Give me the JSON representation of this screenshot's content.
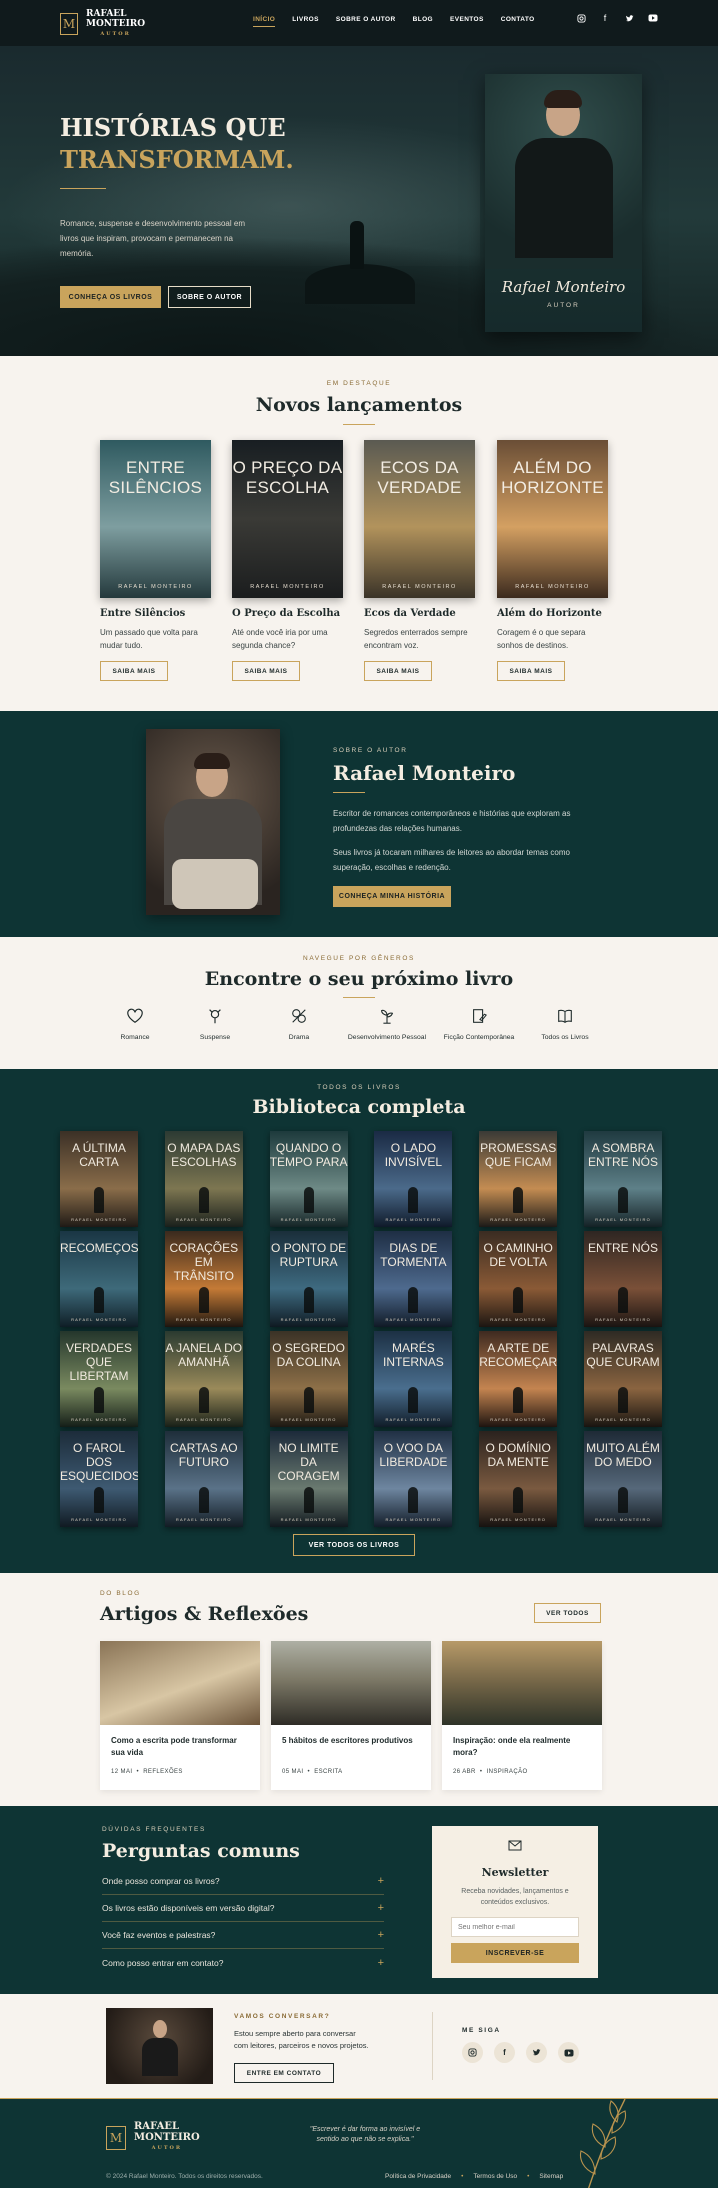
{
  "header": {
    "logo_mark": "M",
    "logo_line1": "RAFAEL",
    "logo_line2": "MONTEIRO",
    "logo_sub": "AUTOR",
    "nav": [
      "INÍCIO",
      "LIVROS",
      "SOBRE O AUTOR",
      "BLOG",
      "EVENTOS",
      "CONTATO"
    ],
    "social_icons": [
      "instagram-icon",
      "facebook-icon",
      "twitter-icon",
      "youtube-icon"
    ]
  },
  "hero": {
    "title_line1": "HISTÓRIAS QUE",
    "title_line2": "TRANSFORMAM.",
    "description": "Romance, suspense e desenvolvimento pessoal em livros que inspiram, provocam e permanecem na memória.",
    "primary_button": "CONHEÇA OS LIVROS",
    "secondary_button": "SOBRE O AUTOR",
    "portrait_signature": "Rafael Monteiro",
    "portrait_role": "AUTOR"
  },
  "releases": {
    "eyebrow": "EM DESTAQUE",
    "title": "Novos lançamentos",
    "books": [
      {
        "cover_title": "ENTRE SILÊNCIOS",
        "cover_author": "RAFAEL MONTEIRO",
        "name": "Entre Silêncios",
        "desc": "Um passado que volta para mudar tudo.",
        "button": "SAIBA MAIS"
      },
      {
        "cover_title": "O PREÇO DA ESCOLHA",
        "cover_author": "RAFAEL MONTEIRO",
        "name": "O Preço da Escolha",
        "desc": "Até onde você iria por uma segunda chance?",
        "button": "SAIBA MAIS"
      },
      {
        "cover_title": "ECOS DA VERDADE",
        "cover_author": "RAFAEL MONTEIRO",
        "name": "Ecos da Verdade",
        "desc": "Segredos enterrados sempre encontram voz.",
        "button": "SAIBA MAIS"
      },
      {
        "cover_title": "ALÉM DO HORIZONTE",
        "cover_author": "RAFAEL MONTEIRO",
        "name": "Além do Horizonte",
        "desc": "Coragem é o que separa sonhos de destinos.",
        "button": "SAIBA MAIS"
      }
    ]
  },
  "about": {
    "eyebrow": "SOBRE O AUTOR",
    "title": "Rafael Monteiro",
    "p1": "Escritor de romances contemporâneos e histórias que exploram as profundezas das relações humanas.",
    "p2": "Seus livros já tocaram milhares de leitores ao abordar temas como superação, escolhas e redenção.",
    "button": "CONHEÇA MINHA HISTÓRIA"
  },
  "genres": {
    "eyebrow": "NAVEGUE POR GÊNEROS",
    "title": "Encontre o seu próximo livro",
    "items": [
      {
        "label": "Romance",
        "icon": "heart-icon"
      },
      {
        "label": "Suspense",
        "icon": "magnifier-icon"
      },
      {
        "label": "Drama",
        "icon": "masks-icon"
      },
      {
        "label": "Desenvolvimento Pessoal",
        "icon": "plant-icon"
      },
      {
        "label": "Ficção Contemporânea",
        "icon": "book-pen-icon"
      },
      {
        "label": "Todos os Livros",
        "icon": "open-book-icon"
      }
    ]
  },
  "library": {
    "eyebrow": "TODOS OS LIVROS",
    "title": "Biblioteca completa",
    "author": "RAFAEL MONTEIRO",
    "books": [
      "A ÚLTIMA CARTA",
      "O MAPA DAS ESCOLHAS",
      "QUANDO O TEMPO PARA",
      "O LADO INVISÍVEL",
      "PROMESSAS QUE FICAM",
      "A SOMBRA ENTRE NÓS",
      "RECOMEÇOS",
      "CORAÇÕES EM TRÂNSITO",
      "O PONTO DE RUPTURA",
      "DIAS DE TORMENTA",
      "O CAMINHO DE VOLTA",
      "ENTRE NÓS",
      "VERDADES QUE LIBERTAM",
      "A JANELA DO AMANHÃ",
      "O SEGREDO DA COLINA",
      "MARÉS INTERNAS",
      "A ARTE DE RECOMEÇAR",
      "PALAVRAS QUE CURAM",
      "O FAROL DOS ESQUECIDOS",
      "CARTAS AO FUTURO",
      "NO LIMITE DA CORAGEM",
      "O VOO DA LIBERDADE",
      "O DOMÍNIO DA MENTE",
      "MUITO ALÉM DO MEDO"
    ],
    "button": "VER TODOS OS LIVROS"
  },
  "blog": {
    "eyebrow": "DO BLOG",
    "title": "Artigos & Reflexões",
    "button": "VER TODOS",
    "posts": [
      {
        "title": "Como a escrita pode transformar sua vida",
        "date": "12 MAI",
        "category": "REFLEXÕES"
      },
      {
        "title": "5 hábitos de escritores produtivos",
        "date": "05 MAI",
        "category": "ESCRITA"
      },
      {
        "title": "Inspiração: onde ela realmente mora?",
        "date": "26 ABR",
        "category": "INSPIRAÇÃO"
      }
    ]
  },
  "faq": {
    "eyebrow": "DÚVIDAS FREQUENTES",
    "title": "Perguntas comuns",
    "items": [
      "Onde posso comprar os livros?",
      "Os livros estão disponíveis em versão digital?",
      "Você faz eventos e palestras?",
      "Como posso entrar em contato?"
    ]
  },
  "newsletter": {
    "title": "Newsletter",
    "desc": "Receba novidades, lançamentos e conteúdos exclusivos.",
    "placeholder": "Seu melhor e-mail",
    "button": "INSCREVER-SE"
  },
  "contact": {
    "eyebrow": "VAMOS CONVERSAR?",
    "desc": "Estou sempre aberto para conversar com leitores, parceiros e novos projetos.",
    "button": "ENTRE EM CONTATO",
    "social_title": "ME SIGA",
    "social_icons": [
      "instagram-icon",
      "facebook-icon",
      "twitter-icon",
      "youtube-icon"
    ]
  },
  "footer": {
    "logo_line1": "RAFAEL",
    "logo_line2": "MONTEIRO",
    "logo_sub": "AUTOR",
    "quote": "\"Escrever é dar forma ao invisível e sentido ao que não se explica.\"",
    "copyright": "© 2024 Rafael Monteiro. Todos os direitos reservados.",
    "links": [
      "Política de Privacidade",
      "Termos de Uso",
      "Sitemap"
    ]
  },
  "colors": {
    "accent_gold": "#c9a45c",
    "dark_teal": "#0e3434",
    "cream": "#f7f3ee",
    "header_dark": "#101a1c"
  }
}
